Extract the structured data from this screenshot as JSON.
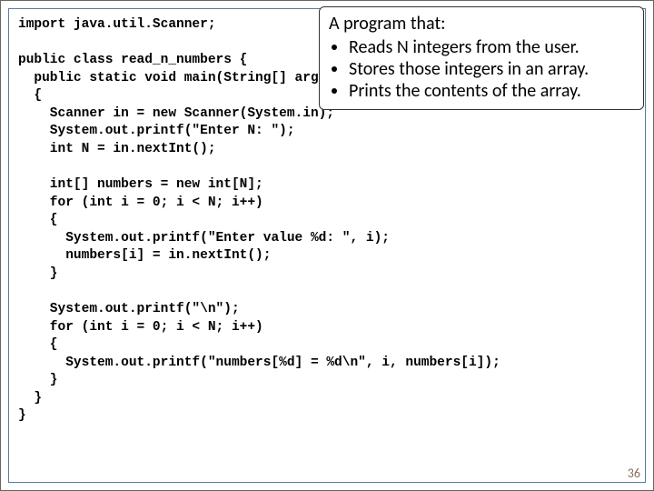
{
  "code": {
    "l1": "import java.util.Scanner;",
    "l2": "",
    "l3": "public class read_n_numbers {",
    "l4": "  public static void main(String[] args)",
    "l5": "  {",
    "l6": "    Scanner in = new Scanner(System.in);",
    "l7": "    System.out.printf(\"Enter N: \");",
    "l8": "    int N = in.nextInt();",
    "l9": "",
    "l10": "    int[] numbers = new int[N];",
    "l11": "    for (int i = 0; i < N; i++)",
    "l12": "    {",
    "l13": "      System.out.printf(\"Enter value %d: \", i);",
    "l14": "      numbers[i] = in.nextInt();",
    "l15": "    }",
    "l16": "",
    "l17": "    System.out.printf(\"\\n\");",
    "l18": "    for (int i = 0; i < N; i++)",
    "l19": "    {",
    "l20": "      System.out.printf(\"numbers[%d] = %d\\n\", i, numbers[i]);",
    "l21": "    }",
    "l22": "  }",
    "l23": "}"
  },
  "callout": {
    "title": "A program that:",
    "b1": "Reads N integers from the user.",
    "b2": "Stores those integers in an array.",
    "b3": "Prints the contents of the array."
  },
  "pageNumber": "36"
}
